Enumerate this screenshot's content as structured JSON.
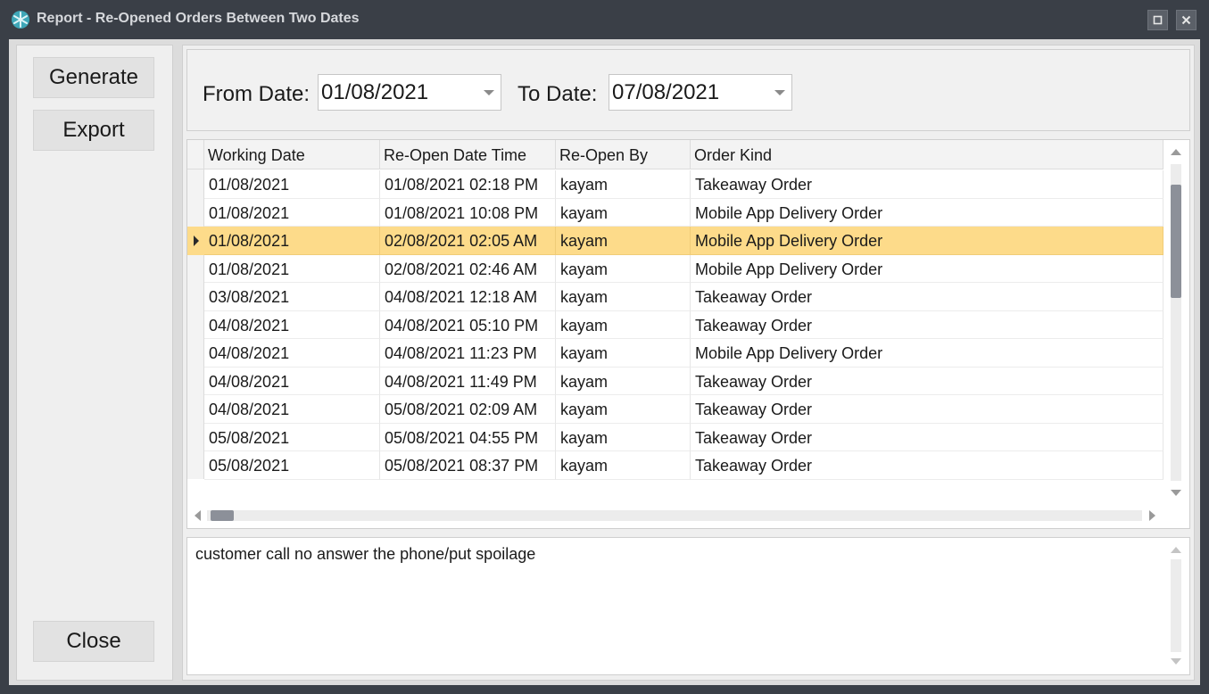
{
  "window": {
    "title": "Report - Re-Opened Orders Between Two Dates",
    "icon": "snowflake-app-icon",
    "controls": [
      "restore-icon",
      "close-icon"
    ]
  },
  "buttons": {
    "generate": "Generate",
    "export": "Export",
    "close": "Close"
  },
  "filters": {
    "from_label": "From Date:",
    "from_value": "01/08/2021",
    "to_label": "To Date:",
    "to_value": "07/08/2021"
  },
  "grid": {
    "columns": [
      "Working Date",
      "Re-Open Date Time",
      "Re-Open By",
      "Order Kind"
    ],
    "selected_row": 2,
    "rows": [
      [
        "01/08/2021",
        "01/08/2021 02:18 PM",
        "kayam",
        "Takeaway Order"
      ],
      [
        "01/08/2021",
        "01/08/2021 10:08 PM",
        "kayam",
        "Mobile App Delivery Order"
      ],
      [
        "01/08/2021",
        "02/08/2021 02:05 AM",
        "kayam",
        "Mobile App Delivery Order"
      ],
      [
        "01/08/2021",
        "02/08/2021 02:46 AM",
        "kayam",
        "Mobile App Delivery Order"
      ],
      [
        "03/08/2021",
        "04/08/2021 12:18 AM",
        "kayam",
        "Takeaway Order"
      ],
      [
        "04/08/2021",
        "04/08/2021 05:10 PM",
        "kayam",
        "Takeaway Order"
      ],
      [
        "04/08/2021",
        "04/08/2021 11:23 PM",
        "kayam",
        "Mobile App Delivery Order"
      ],
      [
        "04/08/2021",
        "04/08/2021 11:49 PM",
        "kayam",
        "Takeaway Order"
      ],
      [
        "04/08/2021",
        "05/08/2021 02:09 AM",
        "kayam",
        "Takeaway Order"
      ],
      [
        "05/08/2021",
        "05/08/2021 04:55 PM",
        "kayam",
        "Takeaway Order"
      ],
      [
        "05/08/2021",
        "05/08/2021 08:37 PM",
        "kayam",
        "Takeaway Order"
      ]
    ]
  },
  "memo": {
    "text": "customer call no answer the phone/put spoilage"
  },
  "colors": {
    "titlebar": "#3a3f47",
    "selected_row": "#fddb8a",
    "scroll_thumb": "#8c9099"
  }
}
